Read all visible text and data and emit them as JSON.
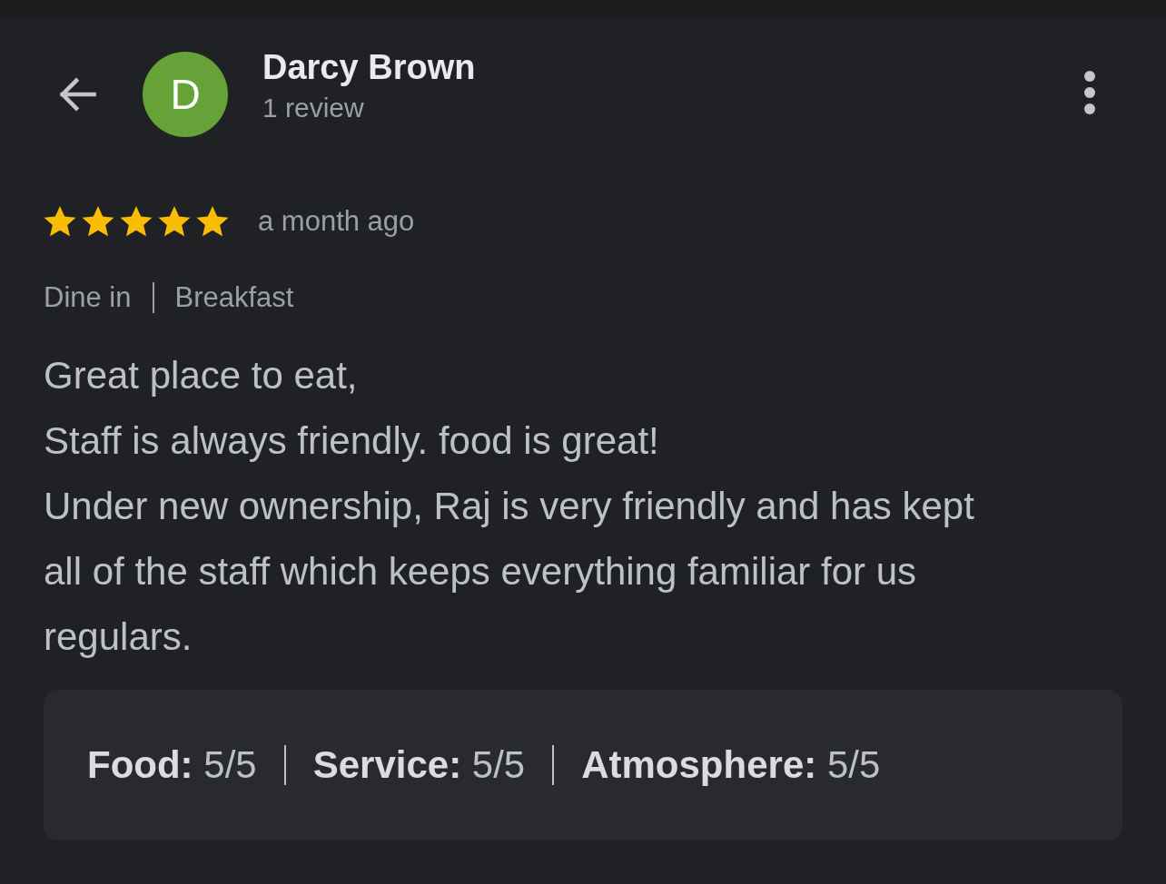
{
  "header": {
    "avatar_initial": "D",
    "name": "Darcy Brown",
    "reviews": "1 review"
  },
  "review": {
    "stars": 5,
    "time": "a month ago",
    "tags": [
      "Dine in",
      "Breakfast"
    ],
    "paragraphs": [
      "Great place to eat,",
      "Staff is always friendly. food is great!",
      "Under new ownership, Raj is very friendly and has kept all of the staff which keeps everything familiar for us regulars."
    ],
    "ratings": [
      "**Food:** 5/5",
      "**Service:** 5/5",
      "**Atmosphere:** 5/5"
    ]
  }
}
